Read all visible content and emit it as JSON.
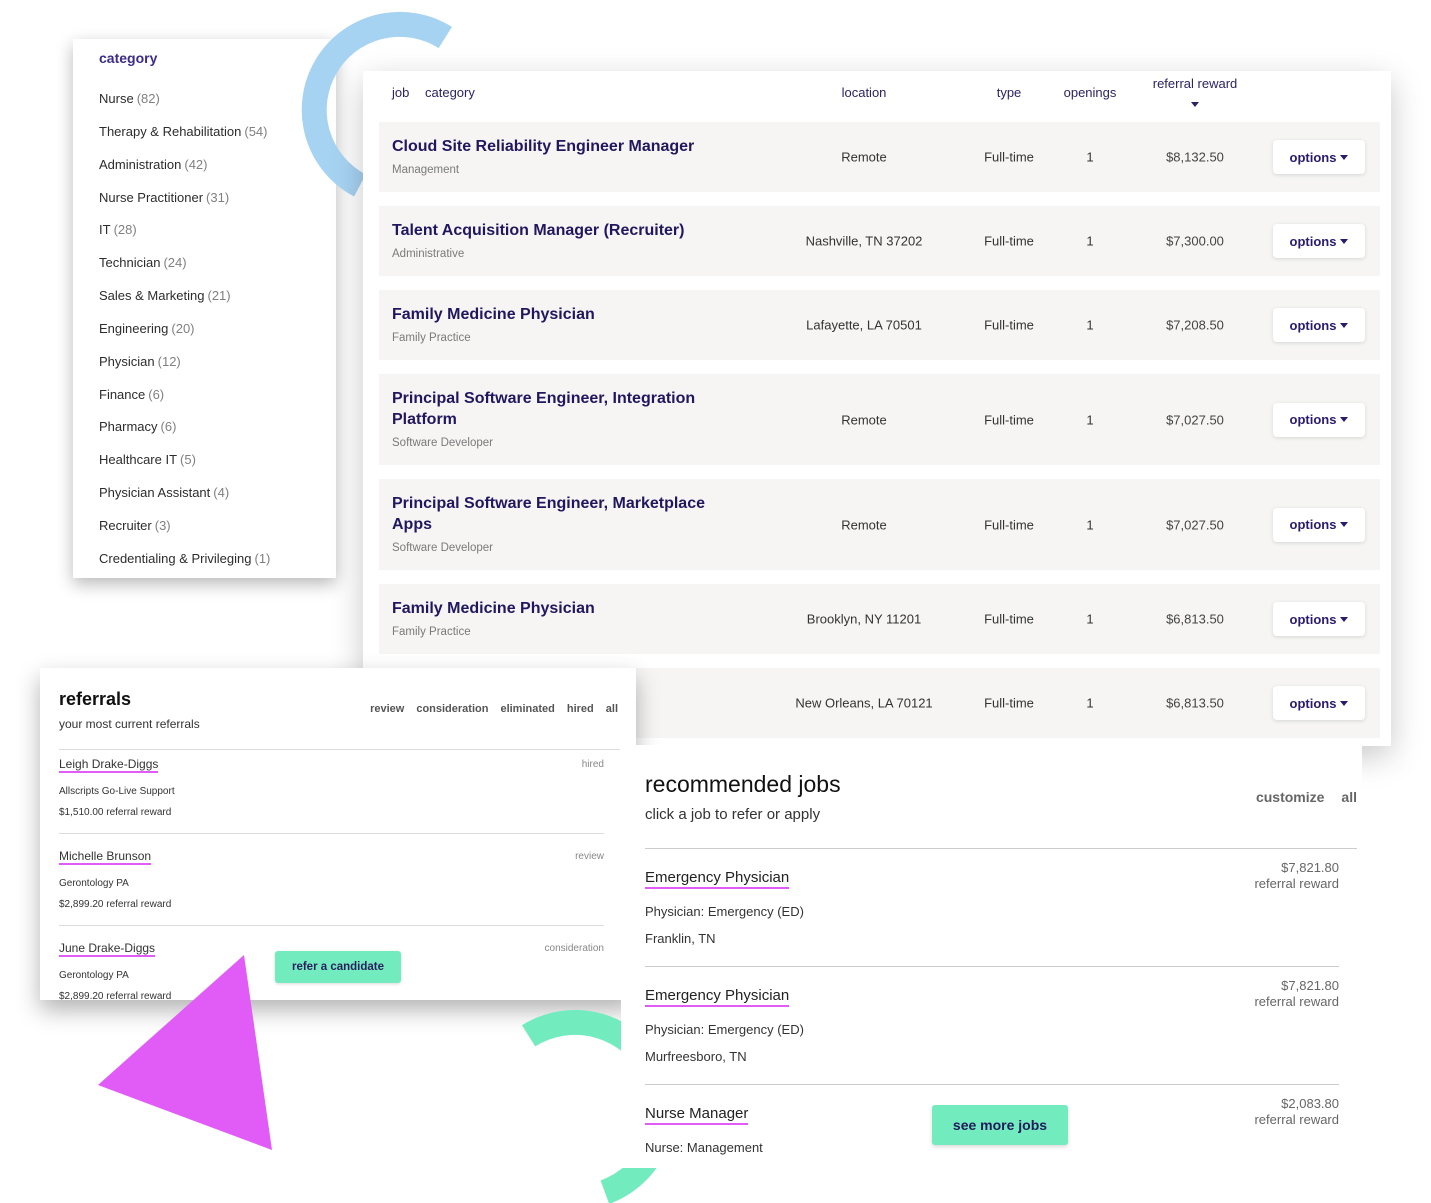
{
  "colors": {
    "accent_green": "#72ecbf",
    "accent_pink": "#e15bf7",
    "accent_blue": "#a7d3f3",
    "primary_text": "#21175f"
  },
  "category_panel": {
    "title": "category",
    "items": [
      {
        "label": "Nurse",
        "count": "(82)"
      },
      {
        "label": "Therapy & Rehabilitation",
        "count": "(54)"
      },
      {
        "label": "Administration",
        "count": "(42)"
      },
      {
        "label": "Nurse Practitioner",
        "count": "(31)"
      },
      {
        "label": "IT",
        "count": "(28)"
      },
      {
        "label": "Technician",
        "count": "(24)"
      },
      {
        "label": "Sales & Marketing",
        "count": "(21)"
      },
      {
        "label": "Engineering",
        "count": "(20)"
      },
      {
        "label": "Physician",
        "count": "(12)"
      },
      {
        "label": "Finance",
        "count": "(6)"
      },
      {
        "label": "Pharmacy",
        "count": "(6)"
      },
      {
        "label": "Healthcare IT",
        "count": "(5)"
      },
      {
        "label": "Physician Assistant",
        "count": "(4)"
      },
      {
        "label": "Recruiter",
        "count": "(3)"
      },
      {
        "label": "Credentialing & Privileging",
        "count": "(1)"
      }
    ]
  },
  "jobs_table": {
    "headers": {
      "job": "job",
      "category": "category",
      "location": "location",
      "type": "type",
      "openings": "openings",
      "referral_reward": "referral reward"
    },
    "sort_icon": "caret-down",
    "options_label": "options",
    "rows": [
      {
        "title": "Cloud Site Reliability Engineer Manager",
        "category": "Management",
        "location": "Remote",
        "type": "Full-time",
        "openings": "1",
        "reward": "$8,132.50"
      },
      {
        "title": "Talent Acquisition Manager (Recruiter)",
        "category": "Administrative",
        "location": "Nashville, TN 37202",
        "type": "Full-time",
        "openings": "1",
        "reward": "$7,300.00"
      },
      {
        "title": "Family Medicine Physician",
        "category": "Family Practice",
        "location": "Lafayette, LA 70501",
        "type": "Full-time",
        "openings": "1",
        "reward": "$7,208.50"
      },
      {
        "title": "Principal Software Engineer, Integration Platform",
        "category": "Software Developer",
        "location": "Remote",
        "type": "Full-time",
        "openings": "1",
        "reward": "$7,027.50"
      },
      {
        "title": "Principal Software Engineer, Marketplace Apps",
        "category": "Software Developer",
        "location": "Remote",
        "type": "Full-time",
        "openings": "1",
        "reward": "$7,027.50"
      },
      {
        "title": "Family Medicine Physician",
        "category": "Family Practice",
        "location": "Brooklyn, NY 11201",
        "type": "Full-time",
        "openings": "1",
        "reward": "$6,813.50"
      },
      {
        "location": "New Orleans, LA 70121",
        "type": "Full-time",
        "openings": "1",
        "reward": "$6,813.50"
      }
    ]
  },
  "referrals": {
    "title": "referrals",
    "subtitle": "your most current referrals",
    "filters": [
      "review",
      "consideration",
      "eliminated",
      "hired",
      "all"
    ],
    "items": [
      {
        "name": "Leigh Drake-Diggs",
        "status": "hired",
        "job": "Allscripts Go-Live Support",
        "reward": "$1,510.00 referral reward"
      },
      {
        "name": "Michelle Brunson",
        "status": "review",
        "job": "Gerontology PA",
        "reward": "$2,899.20 referral reward"
      },
      {
        "name": "June Drake-Diggs",
        "status": "consideration",
        "job": "Gerontology PA",
        "reward": "$2,899.20 referral reward"
      }
    ],
    "refer_button": "refer a candidate"
  },
  "recommended": {
    "title": "recommended jobs",
    "subtitle": "click a job to refer or apply",
    "actions": [
      "customize",
      "all"
    ],
    "items": [
      {
        "title": "Emergency Physician",
        "category": "Physician: Emergency (ED)",
        "location": "Franklin, TN",
        "reward": "$7,821.80",
        "reward_label": "referral reward"
      },
      {
        "title": "Emergency Physician",
        "category": "Physician: Emergency (ED)",
        "location": "Murfreesboro, TN",
        "reward": "$7,821.80",
        "reward_label": "referral reward"
      },
      {
        "title": "Nurse Manager",
        "category": "Nurse: Management",
        "reward": "$2,083.80",
        "reward_label": "referral reward"
      }
    ],
    "see_more_button": "see more jobs"
  }
}
